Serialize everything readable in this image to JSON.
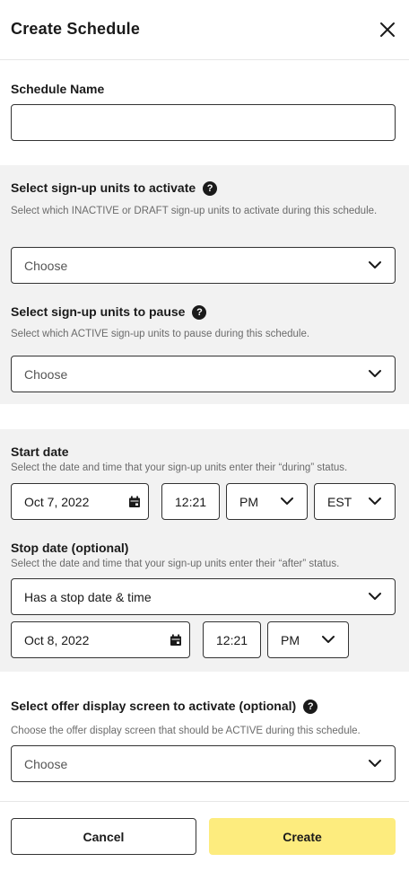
{
  "header": {
    "title": "Create Schedule"
  },
  "schedule_name": {
    "label": "Schedule Name",
    "value": ""
  },
  "activate_units": {
    "label": "Select sign-up units to activate",
    "help": "Select which INACTIVE or DRAFT sign-up units to activate during this schedule.",
    "value": "Choose"
  },
  "pause_units": {
    "label": "Select sign-up units to pause",
    "help": "Select which ACTIVE sign-up units to pause during this schedule.",
    "value": "Choose"
  },
  "start_date": {
    "label": "Start date",
    "help": "Select the date and time that your sign-up units enter their “during” status.",
    "date": "Oct 7, 2022",
    "time": "12:21",
    "ampm": "PM",
    "timezone": "EST"
  },
  "stop_date": {
    "label": "Stop date (optional)",
    "help": "Select the date and time that your sign-up units enter their “after” status.",
    "mode": "Has a stop date & time",
    "date": "Oct 8, 2022",
    "time": "12:21",
    "ampm": "PM"
  },
  "offer_screen": {
    "label": "Select offer display screen to activate (optional)",
    "help": "Choose the offer display screen that should be ACTIVE during this schedule.",
    "value": "Choose"
  },
  "footer": {
    "cancel_label": "Cancel",
    "create_label": "Create"
  },
  "colors": {
    "create_button": "#fdec7e",
    "section_bg": "#f2f2f2",
    "help_text": "#6b6b6b"
  },
  "icons": {
    "close": "close-icon",
    "help": "help-icon",
    "chevron": "chevron-down-icon",
    "calendar": "calendar-icon"
  }
}
